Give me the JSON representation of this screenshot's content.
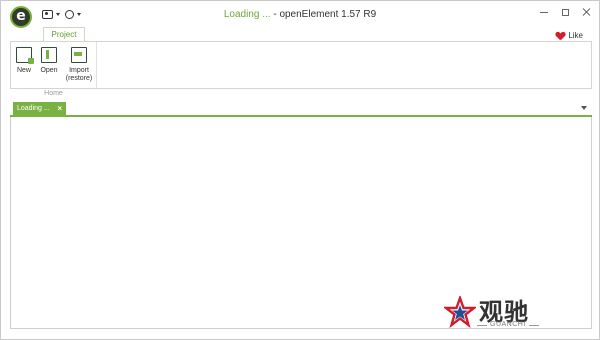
{
  "window": {
    "title_status": "Loading ...",
    "title_separator": " - ",
    "title_app": "openElement 1.57 R9"
  },
  "app_logo": "e",
  "ribbon": {
    "tab_label": "Project",
    "like_label": "Like",
    "group_label": "Home",
    "buttons": [
      {
        "label": "New",
        "icon": "new-file-icon"
      },
      {
        "label": "Open",
        "icon": "open-file-icon"
      },
      {
        "label_line1": "Import",
        "label_line2": "(restore)",
        "icon": "import-icon"
      }
    ]
  },
  "document_tab": {
    "label": "Loading ...",
    "close_glyph": "×"
  },
  "watermark": {
    "text_cn": "观驰",
    "text_en": "GUANCHI"
  },
  "colors": {
    "accent": "#79b243",
    "heart": "#d11d2c",
    "watermark_star_red": "#d11d2c",
    "watermark_star_blue": "#1e4f9a"
  }
}
